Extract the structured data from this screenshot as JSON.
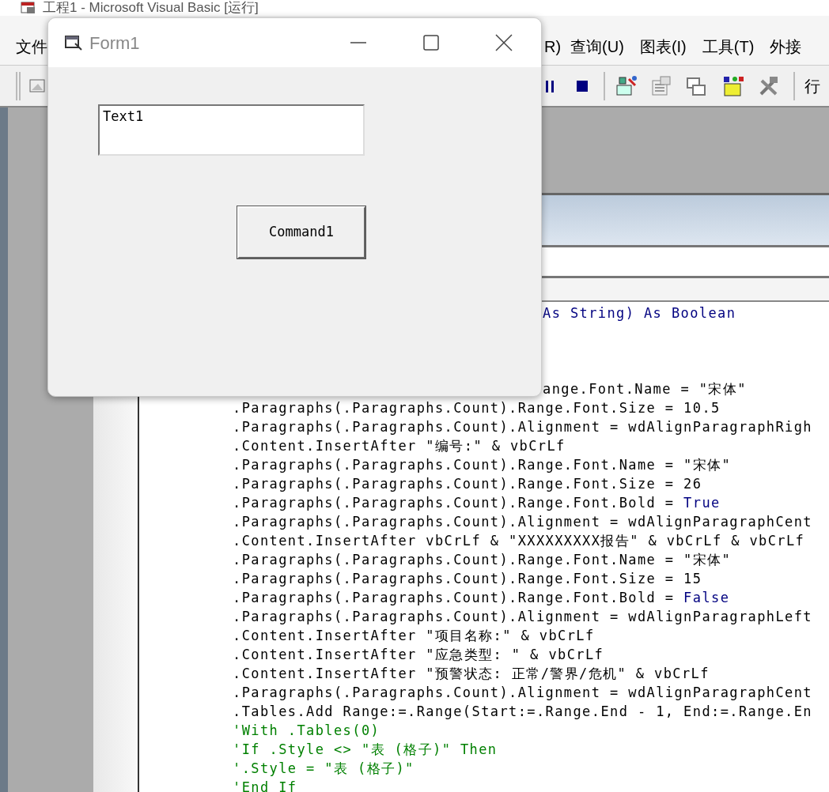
{
  "ide": {
    "title": "工程1 - Microsoft Visual Basic [运行]",
    "menus": [
      "文件",
      "R)",
      "查询(U)",
      "图表(I)",
      "工具(T)",
      "外接"
    ],
    "toolbar_label": "行"
  },
  "form": {
    "title": "Form1",
    "textbox": {
      "value": "Text1"
    },
    "button": "Command1"
  },
  "code_lines": [
    {
      "segments": [
        {
          "kind": "keyword",
          "text": "As String) As Boolean"
        }
      ]
    },
    {
      "segments": [
        {
          "kind": "code",
          "text": "ange.Font.Name = \"宋体\""
        }
      ]
    },
    {
      "segments": [
        {
          "kind": "code",
          "text": ".Paragraphs(.Paragraphs.Count).Range.Font.Size = 10.5"
        }
      ]
    },
    {
      "segments": [
        {
          "kind": "code",
          "text": ".Paragraphs(.Paragraphs.Count).Alignment = wdAlignParagraphRigh"
        }
      ]
    },
    {
      "segments": [
        {
          "kind": "code",
          "text": ".Content.InsertAfter \"编号:\" & vbCrLf"
        }
      ]
    },
    {
      "segments": [
        {
          "kind": "code",
          "text": ".Paragraphs(.Paragraphs.Count).Range.Font.Name = \"宋体\""
        }
      ]
    },
    {
      "segments": [
        {
          "kind": "code",
          "text": ".Paragraphs(.Paragraphs.Count).Range.Font.Size = 26"
        }
      ]
    },
    {
      "segments": [
        {
          "kind": "code",
          "text": ".Paragraphs(.Paragraphs.Count).Range.Font.Bold = "
        },
        {
          "kind": "keyword",
          "text": "True"
        }
      ]
    },
    {
      "segments": [
        {
          "kind": "code",
          "text": ".Paragraphs(.Paragraphs.Count).Alignment = wdAlignParagraphCent"
        }
      ]
    },
    {
      "segments": [
        {
          "kind": "code",
          "text": ".Content.InsertAfter vbCrLf & \"XXXXXXXXX报告\" & vbCrLf & vbCrLf"
        }
      ]
    },
    {
      "segments": [
        {
          "kind": "code",
          "text": ".Paragraphs(.Paragraphs.Count).Range.Font.Name = \"宋体\""
        }
      ]
    },
    {
      "segments": [
        {
          "kind": "code",
          "text": ".Paragraphs(.Paragraphs.Count).Range.Font.Size = 15"
        }
      ]
    },
    {
      "segments": [
        {
          "kind": "code",
          "text": ".Paragraphs(.Paragraphs.Count).Range.Font.Bold = "
        },
        {
          "kind": "keyword",
          "text": "False"
        }
      ]
    },
    {
      "segments": [
        {
          "kind": "code",
          "text": ".Paragraphs(.Paragraphs.Count).Alignment = wdAlignParagraphLeft"
        }
      ]
    },
    {
      "segments": [
        {
          "kind": "code",
          "text": ".Content.InsertAfter \"项目名称:\" & vbCrLf"
        }
      ]
    },
    {
      "segments": [
        {
          "kind": "code",
          "text": ".Content.InsertAfter \"应急类型: \" & vbCrLf"
        }
      ]
    },
    {
      "segments": [
        {
          "kind": "code",
          "text": ".Content.InsertAfter \"预警状态: 正常/警界/危机\" & vbCrLf"
        }
      ]
    },
    {
      "segments": [
        {
          "kind": "code",
          "text": ".Paragraphs(.Paragraphs.Count).Alignment = wdAlignParagraphCent"
        }
      ]
    },
    {
      "segments": [
        {
          "kind": "code",
          "text": ".Tables.Add Range:=.Range(Start:=.Range.End - 1, End:=.Range.En"
        }
      ]
    },
    {
      "segments": [
        {
          "kind": "comment",
          "text": "'With .Tables(0)"
        }
      ]
    },
    {
      "segments": [
        {
          "kind": "comment",
          "text": "'If .Style <> \"表 (格子)\" Then"
        }
      ]
    },
    {
      "segments": [
        {
          "kind": "comment",
          "text": "'.Style = \"表 (格子)\""
        }
      ]
    },
    {
      "segments": [
        {
          "kind": "comment",
          "text": "'End If"
        }
      ]
    }
  ]
}
